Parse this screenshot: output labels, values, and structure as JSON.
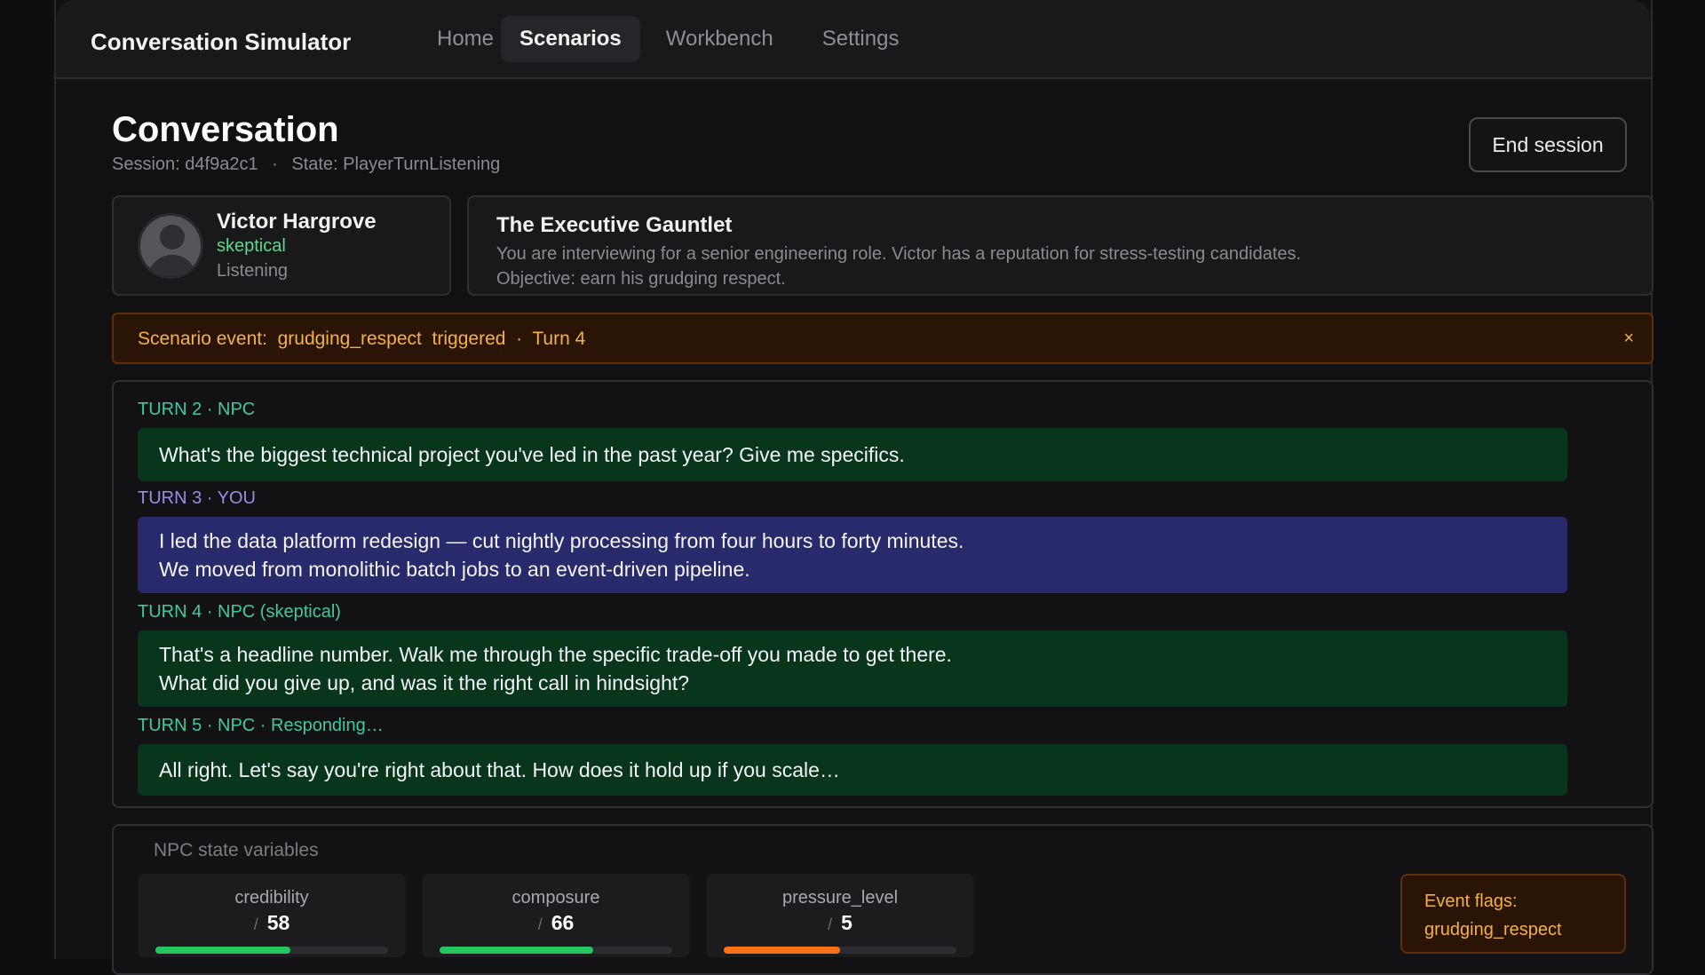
{
  "app": {
    "title": "Conversation Simulator"
  },
  "nav": [
    {
      "label": "Home"
    },
    {
      "label": "Scenarios",
      "active": true
    },
    {
      "label": "Workbench"
    },
    {
      "label": "Settings"
    }
  ],
  "page": {
    "title": "Conversation",
    "session": "Session: d4f9a2c1",
    "separator": "·",
    "state": "State: PlayerTurnListening",
    "end_label": "End session"
  },
  "npc": {
    "name": "Victor Hargrove",
    "mood": "skeptical",
    "status": "Listening"
  },
  "scenario": {
    "title": "The Executive Gauntlet",
    "description": "You are interviewing for a senior engineering role. Victor has a reputation for stress-testing candidates. Objective: earn his grudging respect."
  },
  "event": {
    "text": "Scenario event:  grudging_respect  triggered  ·  Turn 4",
    "close": "×"
  },
  "transcript": [
    {
      "label": "TURN 2  ·  NPC",
      "speaker": "npc",
      "lines": [
        "What's the biggest technical project you've led in the past year? Give me specifics."
      ]
    },
    {
      "label": "TURN 3  ·  YOU",
      "speaker": "you",
      "lines": [
        "I led the data platform redesign — cut nightly processing from four hours to forty minutes.",
        "We moved from monolithic batch jobs to an event-driven pipeline."
      ]
    },
    {
      "label": "TURN 4  ·  NPC  (skeptical)",
      "speaker": "npc",
      "lines": [
        "That's a headline number. Walk me through the specific trade-off you made to get there.",
        "What did you give up, and was it the right call in hindsight?"
      ]
    },
    {
      "label": "TURN 5  ·  NPC  ·  Responding…",
      "speaker": "npc",
      "lines": [
        "All right. Let's say you're right about that. How does it hold up if you scale…"
      ]
    }
  ],
  "state": {
    "title": "NPC state variables",
    "metrics": [
      {
        "name": "credibility",
        "value": "58",
        "slash": "/",
        "fraction": 0.58,
        "color": "#22c55e"
      },
      {
        "name": "composure",
        "value": "66",
        "slash": "/",
        "fraction": 0.66,
        "color": "#22c55e"
      },
      {
        "name": "pressure_level",
        "value": "5",
        "slash": "/",
        "fraction": 0.5,
        "color": "#f97316"
      }
    ],
    "flags_label": "Event flags:",
    "flags_value": "grudging_respect"
  }
}
